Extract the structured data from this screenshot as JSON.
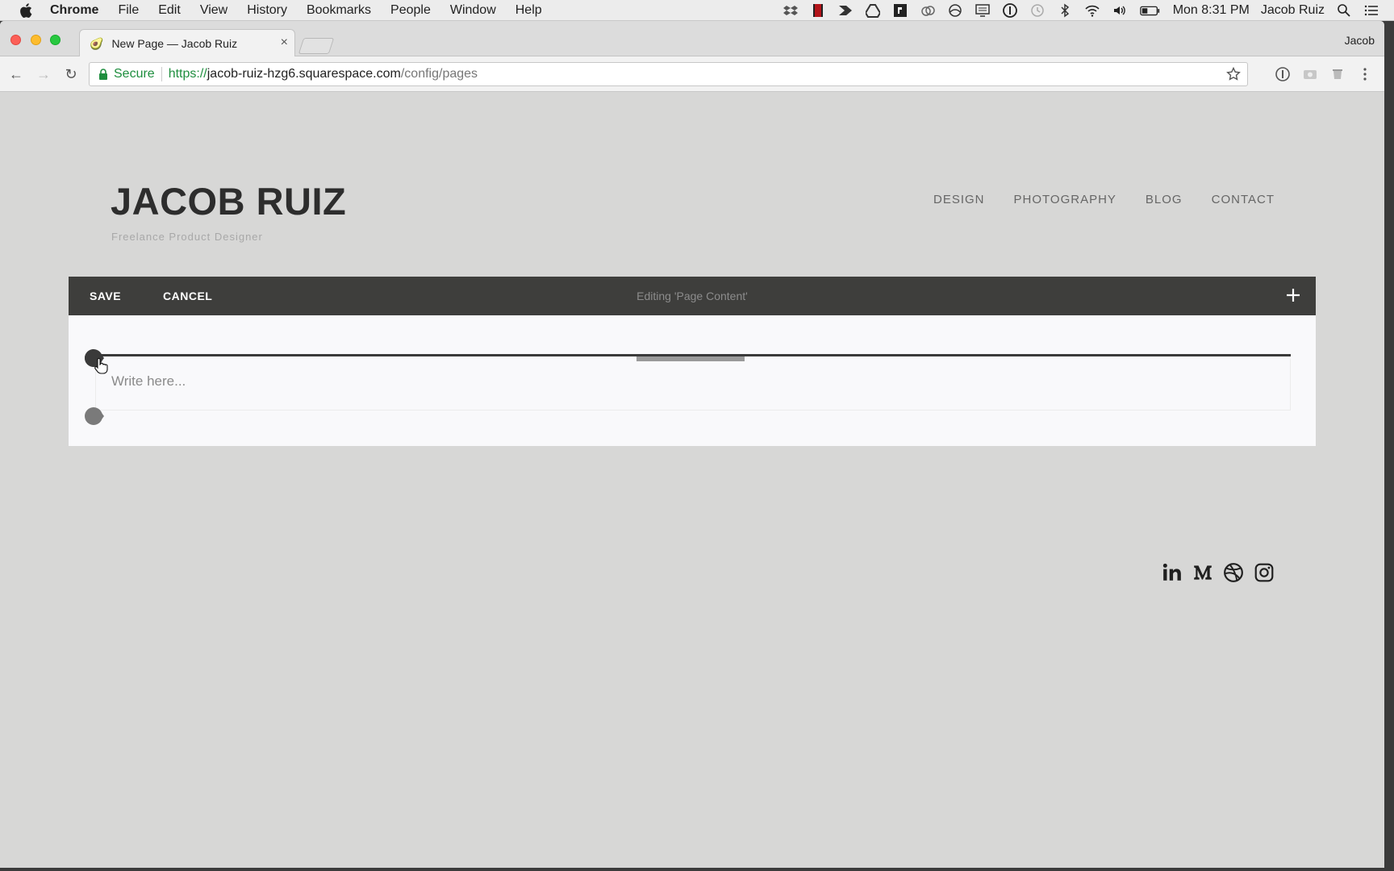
{
  "menubar": {
    "app": "Chrome",
    "items": [
      "File",
      "Edit",
      "View",
      "History",
      "Bookmarks",
      "People",
      "Window",
      "Help"
    ],
    "clock": "Mon 8:31 PM",
    "user": "Jacob Ruiz"
  },
  "browser": {
    "tab_title": "New Page — Jacob Ruiz",
    "profile": "Jacob",
    "url": {
      "secure_label": "Secure",
      "scheme": "https://",
      "host": "jacob-ruiz-hzg6.squarespace.com",
      "path": "/config/pages"
    }
  },
  "site": {
    "title": "JACOB RUIZ",
    "tagline": "Freelance Product Designer",
    "nav": [
      "DESIGN",
      "PHOTOGRAPHY",
      "BLOG",
      "CONTACT"
    ]
  },
  "editor": {
    "save_label": "SAVE",
    "cancel_label": "CANCEL",
    "status": "Editing 'Page Content'",
    "text_placeholder": "Write here..."
  },
  "social_icons": [
    "linkedin-icon",
    "medium-icon",
    "dribbble-icon",
    "instagram-icon"
  ],
  "colors": {
    "page_bg": "#d7d7d6",
    "editbar_bg": "#3e3e3c",
    "content_bg": "#f9f9fb",
    "secure_green": "#1e8e3e"
  }
}
